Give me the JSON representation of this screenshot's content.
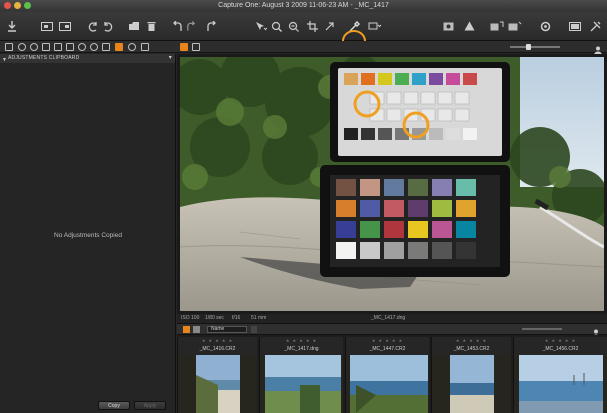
{
  "window": {
    "title": "Capture One: August 3 2009 11-06-23 AM - _MC_1417"
  },
  "colors": {
    "accent": "#e8841c",
    "highlight_ring": "#f0a020"
  },
  "toolbar": {
    "icons": [
      "import-icon",
      "capture-icon",
      "export-icon",
      "undo-icon",
      "redo-icon",
      "copy-adjustments-icon",
      "delete-icon",
      "rotate-left-icon",
      "rotate-right-icon",
      "reset-icon",
      "pan-tool-icon",
      "zoom-tool-icon",
      "crop-tool-icon",
      "straighten-tool-icon",
      "keystone-tool-icon",
      "white-balance-picker-icon",
      "spot-removal-tool-icon",
      "proof-icon",
      "exposure-warning-icon",
      "compare-icon",
      "customize-icon",
      "settings-icon",
      "view-icon",
      "tools-icon"
    ]
  },
  "left_panel": {
    "header": "ADJUSTMENTS CLIPBOARD",
    "empty_message": "No Adjustments Copied",
    "copy_button": "Copy",
    "apply_button": "Apply"
  },
  "info_bar": {
    "iso": "ISO 100",
    "shutter": "1/80 sec",
    "aperture": "f/16",
    "focal": "51 mm",
    "filename": "_MC_1417.dng"
  },
  "browser": {
    "sort_label": "Name",
    "thumbnails": [
      {
        "name": "_MC_1416.CR2",
        "rating": "★ ★ ★ ★ ★"
      },
      {
        "name": "_MC_1417.dng",
        "rating": "★ ★ ★ ★ ★"
      },
      {
        "name": "_MC_1447.CR2",
        "rating": "★ ★ ★ ★ ★"
      },
      {
        "name": "_MC_1453.CR2",
        "rating": "★ ★ ★ ★ ★"
      },
      {
        "name": "_MC_1456.CR2",
        "rating": "★ ★ ★ ★ ★"
      }
    ]
  }
}
